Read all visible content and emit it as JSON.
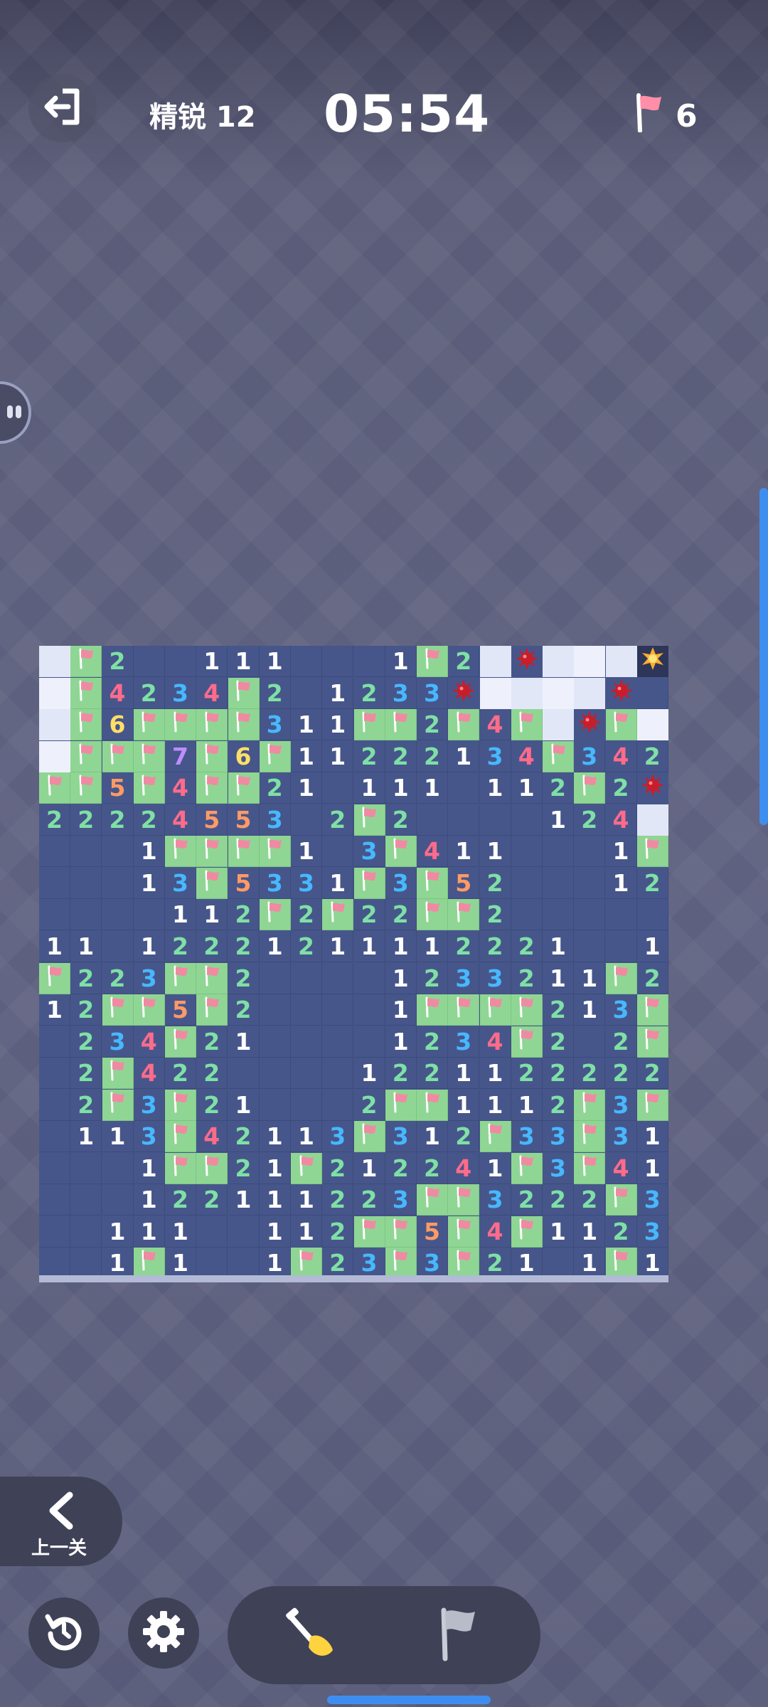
{
  "header": {
    "level_label": "精锐 12",
    "timer": "05:54",
    "flags_remaining": "6"
  },
  "navigation": {
    "back_label": "上一关"
  },
  "icons": {
    "exit": "exit-icon",
    "flag": "flag-icon",
    "back": "chevron-left-icon",
    "restart": "restart-icon",
    "settings": "gear-icon",
    "dig_tool": "shovel-icon",
    "flag_tool": "flag-tool-icon"
  },
  "colors": {
    "1": "#ffffff",
    "2": "#7fe0a6",
    "3": "#47b8ff",
    "4": "#ff6b8a",
    "5": "#ff9a66",
    "6": "#ffe066",
    "7": "#c08cff",
    "flag_cell": "#8fd694",
    "number_cell": "#46568a",
    "hidden_cell": "#e2e7f7"
  },
  "board": {
    "cols": 20,
    "legend": "digit=number cell, F=flag, .=empty, H=hidden, M=mine, X=exploded mine",
    "rows": [
      "HF2..111...1F2HMHHHX",
      "HF4234F2.1233MHHHHM.",
      "HF6FFFF311FF2F4FHMFH",
      "HFFF7F6F11222134F342",
      "FF5F4FF21.111.112F2M",
      "22224553.2F2....124H",
      "...1FFFF1.3F411...1FF",
      "...13F5331F3F52...122",
      "....112F2F22FF2.....",
      "11.12221211112221..111",
      "F223FF2....1233211F2",
      "12FF5F2....1FFFF213F",
      ".234F21....1234F2.2F",
      ".2F422....1221122222",
      ".2F3F21...2FF1112F3F1",
      ".113F42113F312F33F31",
      "...1FF21F212241F3F41",
      "...122111223FF3222F3F",
      "..111..112FF5F4F1123 2",
      "..1F1..1F23F3F21.1F1"
    ]
  }
}
